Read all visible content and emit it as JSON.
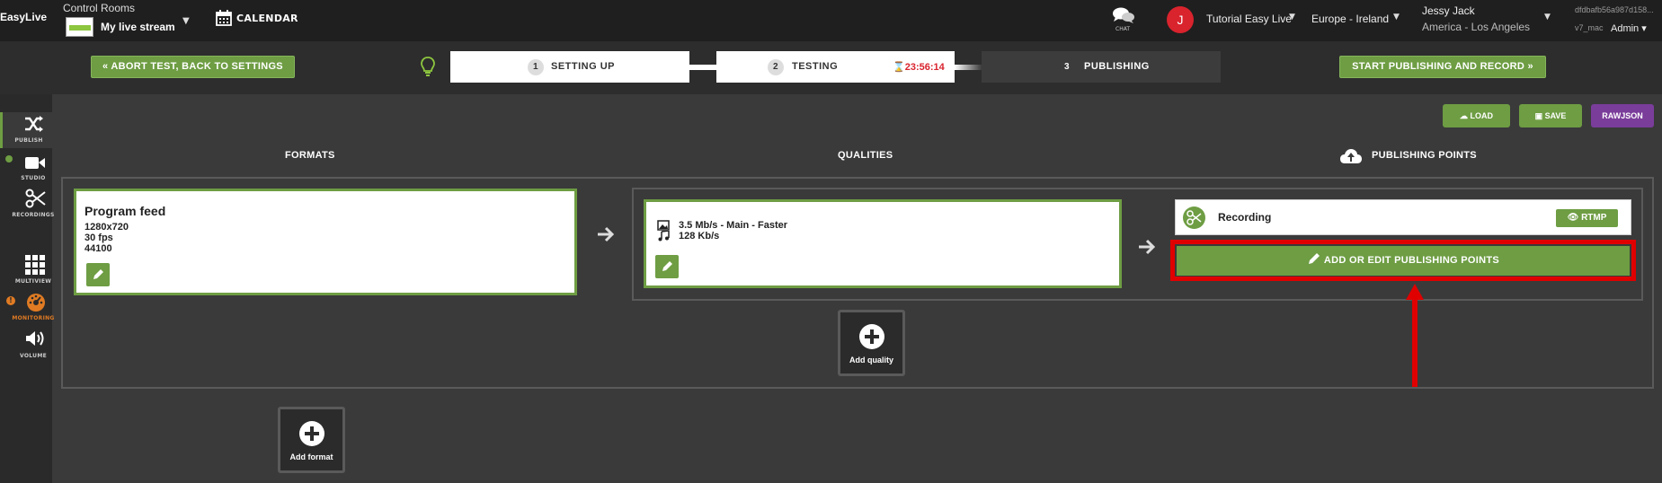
{
  "header": {
    "logo_text": "EasyLive",
    "control_rooms_label": "Control Rooms",
    "control_room_name": "My live stream",
    "calendar_label": "CALENDAR",
    "chat_label": "CHAT",
    "avatar_initial": "J",
    "organization": "Tutorial Easy Live",
    "region": "Europe - Ireland",
    "user_name": "Jessy Jack",
    "user_timezone": "America - Los Angeles",
    "session_id": "dfdbafb56a987d158...",
    "version": "v7_mac",
    "role": "Admin"
  },
  "workflow": {
    "abort_label": "ABORT TEST, BACK TO SETTINGS",
    "start_label": "START PUBLISHING AND RECORD",
    "steps": [
      {
        "num": "1",
        "label": "SETTING UP"
      },
      {
        "num": "2",
        "label": "TESTING"
      },
      {
        "num": "3",
        "label": "PUBLISHING"
      }
    ],
    "timer": "23:56:14"
  },
  "sidebar": {
    "items": [
      {
        "label": "PUBLISH",
        "icon": "shuffle-icon"
      },
      {
        "label": "STUDIO",
        "icon": "video-camera-icon"
      },
      {
        "label": "RECORDINGS",
        "icon": "scissors-icon"
      },
      {
        "label": "MULTIVIEW",
        "icon": "grid-icon"
      },
      {
        "label": "MONITORING",
        "icon": "gauge-icon"
      },
      {
        "label": "VOLUME",
        "icon": "speaker-icon"
      }
    ],
    "alert_mark": "!"
  },
  "toolbar": {
    "load_label": "LOAD",
    "save_label": "SAVE",
    "raw_label": "RAWJSON"
  },
  "columns": {
    "formats": "FORMATS",
    "qualities": "QUALITIES",
    "publishing_points": "PUBLISHING POINTS"
  },
  "format": {
    "title": "Program feed",
    "resolution": "1280x720",
    "fps": "30 fps",
    "audio_rate": "44100"
  },
  "quality": {
    "video": "3.5 Mb/s  -  Main  -  Faster",
    "audio": "128 Kb/s"
  },
  "publishing_point": {
    "label": "Recording",
    "protocol": "RTMP",
    "add_label": "ADD OR EDIT PUBLISHING POINTS"
  },
  "add_quality_label": "Add quality",
  "add_format_label": "Add format",
  "colors": {
    "accent_green": "#6e9d43",
    "highlight_red": "#e00000",
    "raw_purple": "#7a3d9a",
    "timer_red": "#d9232d"
  }
}
